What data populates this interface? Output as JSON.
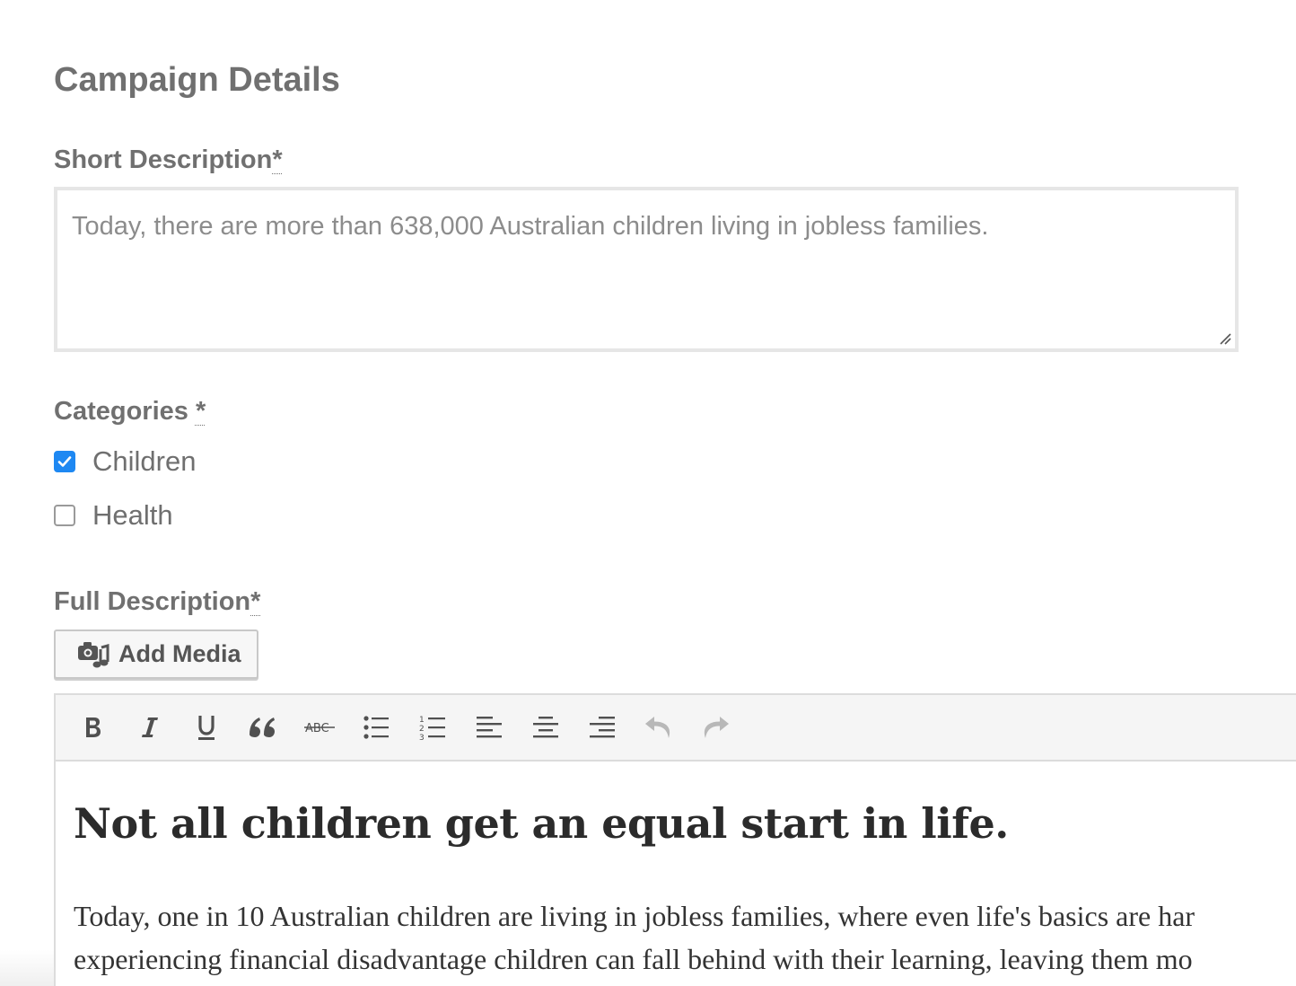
{
  "form": {
    "section_title": "Campaign Details",
    "short_description": {
      "label": "Short Description",
      "required_mark": "*",
      "placeholder": "Today, there are more than 638,000 Australian children living in jobless families."
    },
    "categories": {
      "label": "Categories ",
      "required_mark": "*",
      "options": [
        {
          "label": "Children",
          "checked": true
        },
        {
          "label": "Health",
          "checked": false
        }
      ]
    },
    "full_description": {
      "label": "Full Description",
      "required_mark": "*",
      "add_media_label": "Add Media"
    }
  },
  "editor": {
    "toolbar_icons": [
      "bold-icon",
      "italic-icon",
      "underline-icon",
      "blockquote-icon",
      "strikethrough-icon",
      "bullet-list-icon",
      "numbered-list-icon",
      "align-left-icon",
      "align-center-icon",
      "align-right-icon",
      "undo-icon",
      "redo-icon"
    ],
    "heading": "Not all children get an equal start in life.",
    "paragraph_line_1": "Today, one in 10 Australian children are living in jobless families, where even life's basics are har",
    "paragraph_line_2": "experiencing financial disadvantage children can fall behind with their learning, leaving them mo"
  },
  "colors": {
    "checkbox_checked": "#1e88f2",
    "label_text": "#707070"
  }
}
